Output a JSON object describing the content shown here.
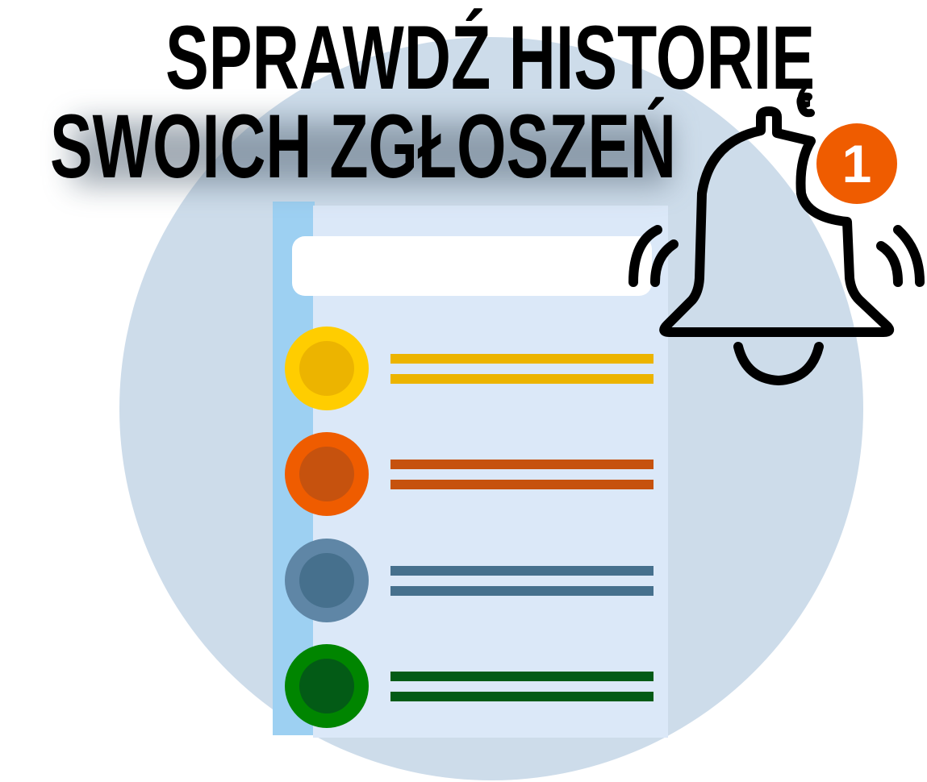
{
  "title": {
    "line1": "SPRAWDŹ HISTORIĘ",
    "line2": "SWOICH ZGŁOSZEŃ"
  },
  "notification": {
    "icon": "bell-icon",
    "badge_count": "1",
    "badge_color": "#ef5c00"
  },
  "colors": {
    "background_circle": "#cddcea",
    "sidebar": "#9dd0f2",
    "page": "#dbe8f8",
    "search_bar": "#ffffff"
  },
  "list_items": [
    {
      "outer": "#ffcd00",
      "inner": "#ecb400",
      "line": "#ecb400"
    },
    {
      "outer": "#ef5c00",
      "inner": "#c6520e",
      "line": "#c6520e"
    },
    {
      "outer": "#5f86a6",
      "inner": "#46708d",
      "line": "#46708d"
    },
    {
      "outer": "#008500",
      "inner": "#035b16",
      "line": "#035b16"
    }
  ]
}
